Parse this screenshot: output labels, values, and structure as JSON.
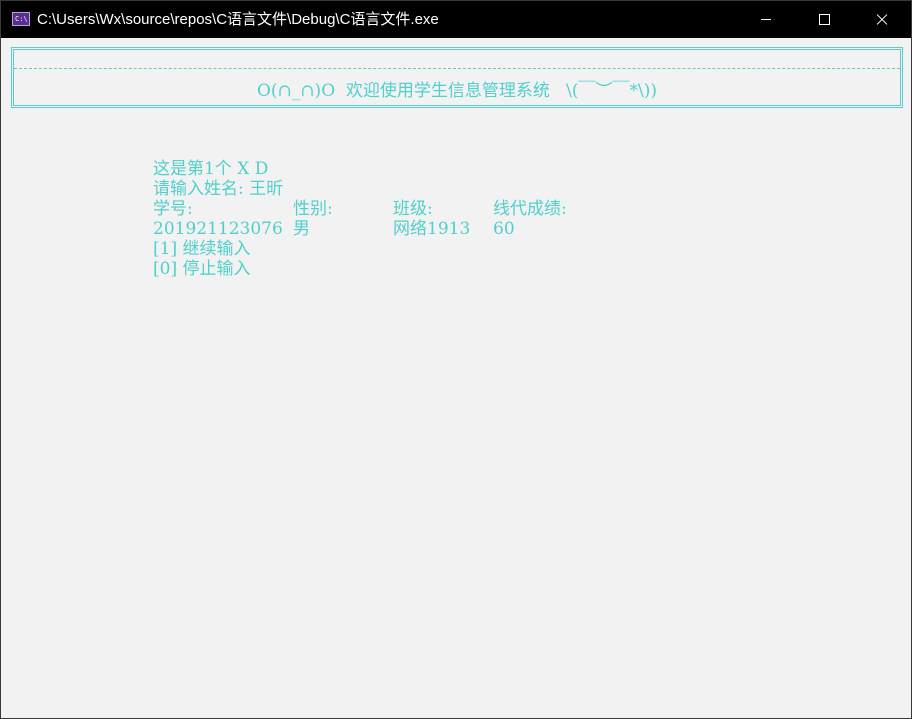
{
  "window": {
    "title": "C:\\Users\\Wx\\source\\repos\\C语言文件\\Debug\\C语言文件.exe",
    "icon": "console-app-icon",
    "icon_text": "C:\\",
    "controls": [
      "minimize-icon",
      "maximize-icon",
      "close-icon"
    ]
  },
  "console": {
    "text_color": "#4fd0cc",
    "background": "#f2f2f2",
    "banner": {
      "title": "O(∩_∩)O  欢迎使用学生信息管理系统   \\(￣︶￣*\\))"
    },
    "record_line": "这是第1个 X D",
    "name_prompt": "请输入姓名: 王昕",
    "headers": {
      "student_id": "学号:",
      "gender": "性别:",
      "class": "班级:",
      "score": "线代成绩:"
    },
    "values": {
      "student_id": "201921123076",
      "gender": "男",
      "class": "网络1913",
      "score": "60"
    },
    "menu": {
      "continue": "[1] 继续输入",
      "stop": "[0] 停止输入"
    }
  }
}
